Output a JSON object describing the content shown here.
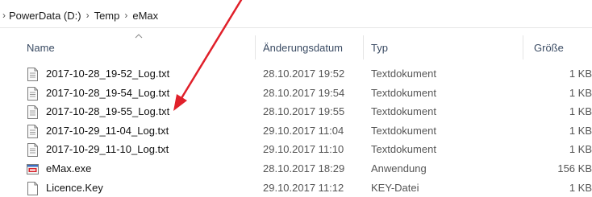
{
  "breadcrumb": {
    "items": [
      "PowerData (D:)",
      "Temp",
      "eMax"
    ]
  },
  "columns": {
    "name": "Name",
    "date": "Änderungsdatum",
    "type": "Typ",
    "size": "Größe"
  },
  "files": [
    {
      "name": "2017-10-28_19-52_Log.txt",
      "date": "28.10.2017 19:52",
      "type": "Textdokument",
      "size": "1 KB",
      "icon": "text-file-icon"
    },
    {
      "name": "2017-10-28_19-54_Log.txt",
      "date": "28.10.2017 19:54",
      "type": "Textdokument",
      "size": "1 KB",
      "icon": "text-file-icon"
    },
    {
      "name": "2017-10-28_19-55_Log.txt",
      "date": "28.10.2017 19:55",
      "type": "Textdokument",
      "size": "1 KB",
      "icon": "text-file-icon"
    },
    {
      "name": "2017-10-29_11-04_Log.txt",
      "date": "29.10.2017 11:04",
      "type": "Textdokument",
      "size": "1 KB",
      "icon": "text-file-icon"
    },
    {
      "name": "2017-10-29_11-10_Log.txt",
      "date": "29.10.2017 11:10",
      "type": "Textdokument",
      "size": "1 KB",
      "icon": "text-file-icon"
    },
    {
      "name": "eMax.exe",
      "date": "28.10.2017 18:29",
      "type": "Anwendung",
      "size": "156 KB",
      "icon": "application-icon"
    },
    {
      "name": "Licence.Key",
      "date": "29.10.2017 11:12",
      "type": "KEY-Datei",
      "size": "1 KB",
      "icon": "blank-file-icon"
    }
  ],
  "annotation": {
    "color": "#e0202a"
  }
}
